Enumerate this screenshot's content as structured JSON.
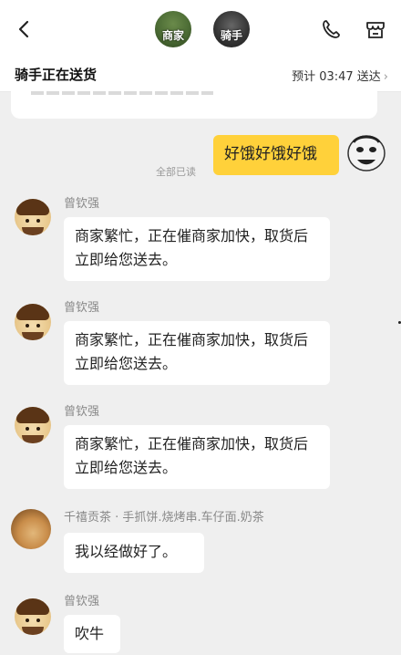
{
  "header": {
    "shop_tag": "商家",
    "rider_tag": "骑手"
  },
  "status": {
    "title": "骑手正在送货",
    "eta": "预计 03:47 送达"
  },
  "messages": {
    "mine_text": "好饿好饿好饿",
    "read_status": "全部已读",
    "m1_name": "曾钦强",
    "m1_text": "商家繁忙，正在催商家加快，取货后立即给您送去。",
    "m2_name": "曾钦强",
    "m2_text": "商家繁忙，正在催商家加快，取货后立即给您送去。",
    "m3_name": "曾钦强",
    "m3_text": "商家繁忙，正在催商家加快，取货后立即给您送去。",
    "m4_name": "千禧贡茶 · 手抓饼.烧烤串.车仔面.奶茶",
    "m4_text": "我以经做好了。",
    "m5_name": "曾钦强",
    "m5_text": "吹牛"
  },
  "icons": {
    "back": "chevron-left-icon",
    "phone": "phone-icon",
    "shop": "store-icon"
  },
  "colors": {
    "my_bubble": "#ffd13a",
    "background": "#efefef"
  }
}
